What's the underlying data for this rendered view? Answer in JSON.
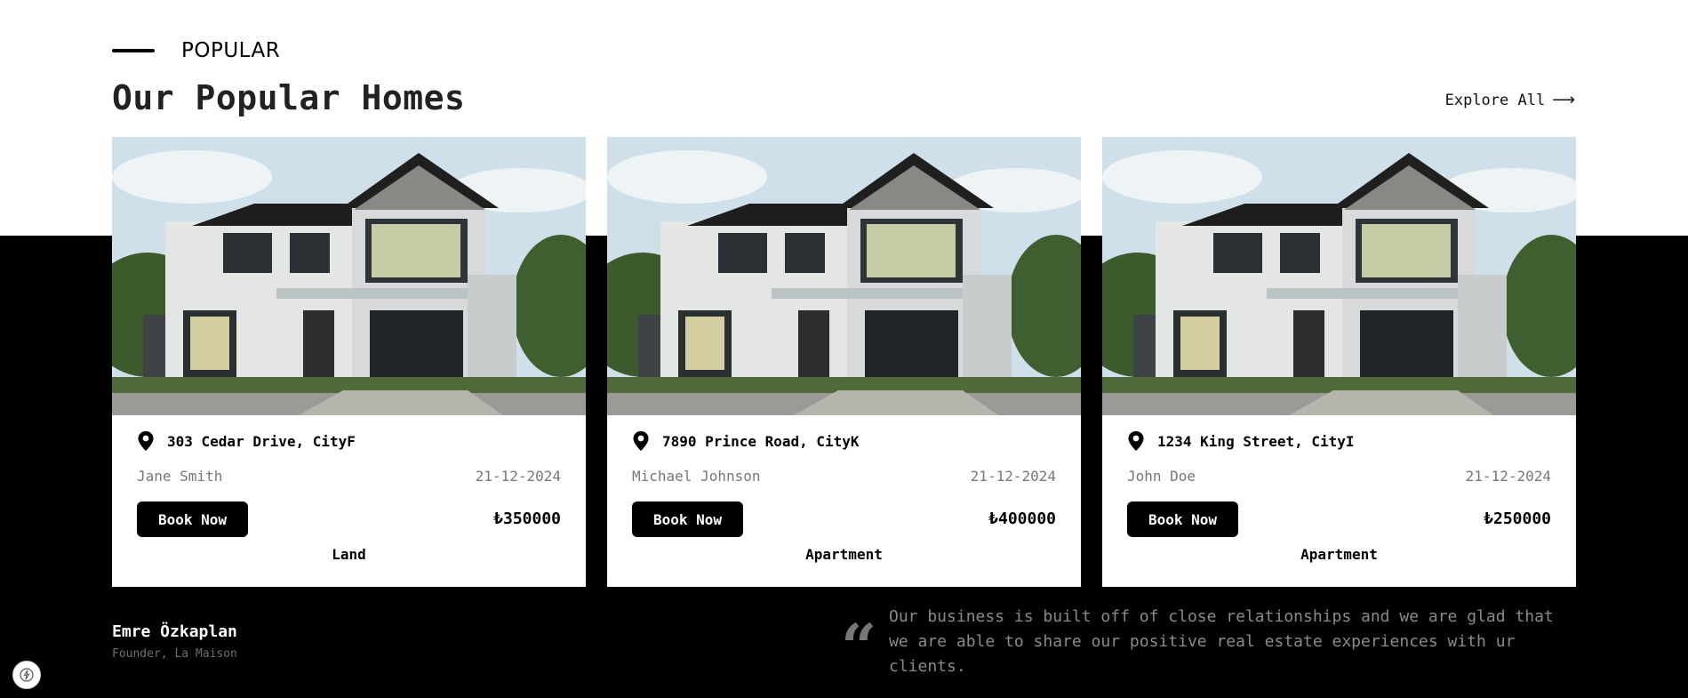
{
  "section": {
    "eyebrow": "POPULAR",
    "title": "Our Popular Homes",
    "explore_label": "Explore All",
    "explore_arrow": "⟶"
  },
  "cards": [
    {
      "address": "303 Cedar Drive, CityF",
      "owner": "Jane Smith",
      "date": "21-12-2024",
      "book_label": "Book Now",
      "price": "₺350000",
      "type": "Land"
    },
    {
      "address": "7890 Prince Road, CityK",
      "owner": "Michael Johnson",
      "date": "21-12-2024",
      "book_label": "Book Now",
      "price": "₺400000",
      "type": "Apartment"
    },
    {
      "address": "1234 King Street, CityI",
      "owner": "John Doe",
      "date": "21-12-2024",
      "book_label": "Book Now",
      "price": "₺250000",
      "type": "Apartment"
    }
  ],
  "testimonial": {
    "name": "Emre Özkaplan",
    "role": "Founder, La Maison",
    "quote_mark": "“",
    "text": "Our business is built off of close relationships and we are glad that we are able to share our positive real estate experiences with ur clients."
  },
  "icons": {
    "pin": "map-pin-icon",
    "quote": "quote-icon",
    "badge": "lightning-icon"
  },
  "colors": {
    "background": "#ffffff",
    "band": "#000000",
    "button": "#000000",
    "muted_text": "#777777"
  }
}
